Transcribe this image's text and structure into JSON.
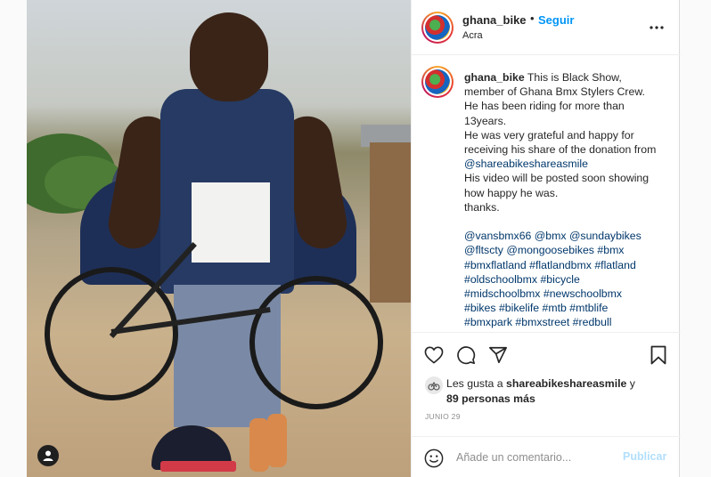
{
  "header": {
    "username": "ghana_bike",
    "separator": "•",
    "follow_label": "Seguir",
    "location": "Acra"
  },
  "caption": {
    "username": "ghana_bike",
    "line1": "This is Black Show, member of Ghana Bmx Stylers Crew.",
    "line2": "He has been riding for more than 13years.",
    "line3_prefix": "He was very grateful and happy for receiving his share of the donation from",
    "line3_mention": "@shareabikeshareasmile",
    "line4": "His video will be posted soon showing how happy he was.",
    "line5": "thanks.",
    "tags": [
      "@vansbmx66",
      "@bmx",
      "@sundaybikes",
      "@fltscty",
      "@mongoosebikes",
      "#bmx",
      "#bmxflatland",
      "#flatlandbmx",
      "#flatland",
      "#oldschoolbmx",
      "#bicycle",
      "#midschoolbmx",
      "#newschoolbmx",
      "#bikes",
      "#bikelife",
      "#mtb",
      "#mtblife",
      "#bmxpark",
      "#bmxstreet",
      "#redbull"
    ]
  },
  "likes": {
    "prefix": "Les gusta a",
    "user": "shareabikeshareasmile",
    "conj": "y",
    "others": "89 personas más"
  },
  "date": "JUNIO 29",
  "comment": {
    "placeholder": "Añade un comentario...",
    "publish_label": "Publicar"
  },
  "icons": {
    "like": "heart-icon",
    "comment": "comment-bubble-icon",
    "share": "paper-plane-icon",
    "save": "bookmark-icon",
    "more": "more-dots-icon",
    "emoji": "smiley-icon",
    "user_tag": "person-icon"
  },
  "colors": {
    "link_blue": "#0095f6",
    "hashtag": "#00376b",
    "publish_disabled": "#b2dffc",
    "muted": "#8e8e8e"
  }
}
